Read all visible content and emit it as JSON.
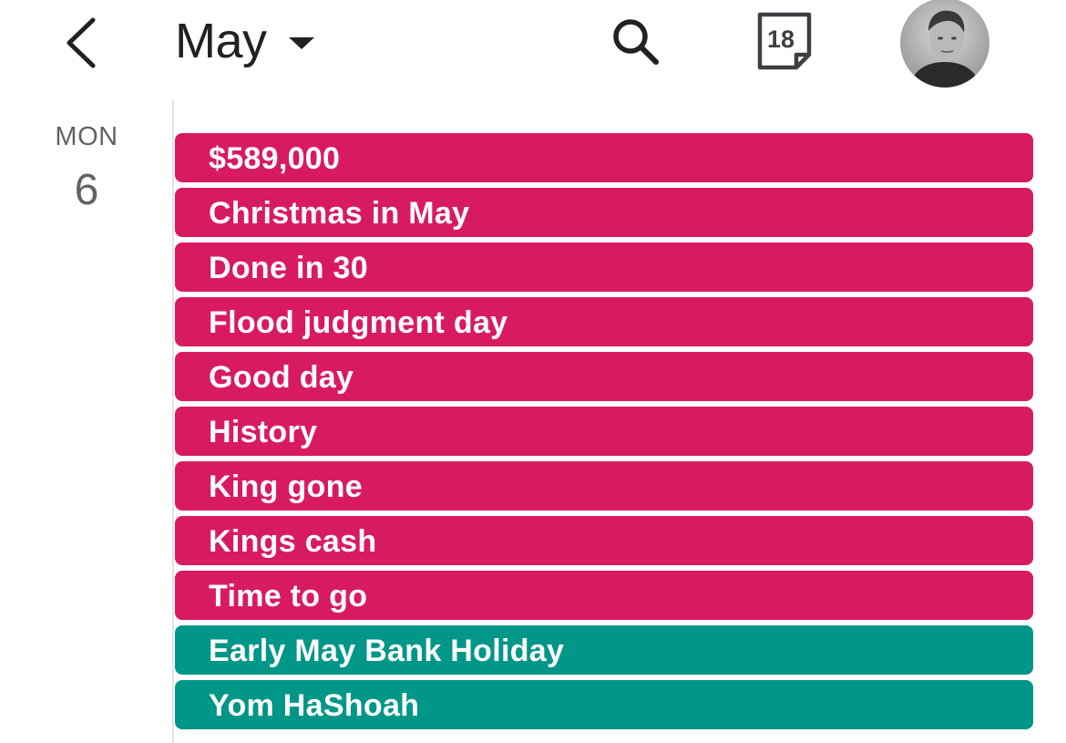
{
  "header": {
    "month": "May",
    "today_date": "18",
    "icons": {
      "back": "chevron-left-icon",
      "dropdown": "caret-down-icon",
      "search": "search-icon",
      "today": "calendar-today-icon",
      "avatar": "user-avatar"
    }
  },
  "day": {
    "name": "MON",
    "number": "6"
  },
  "colors": {
    "personal_event": "#d81b60",
    "holiday_event": "#009688",
    "text_primary": "#202124",
    "text_secondary": "#5f6368"
  },
  "events": [
    {
      "title": "$589,000",
      "color": "#d81b60"
    },
    {
      "title": "Christmas in May",
      "color": "#d81b60"
    },
    {
      "title": "Done in 30",
      "color": "#d81b60"
    },
    {
      "title": "Flood judgment day",
      "color": "#d81b60"
    },
    {
      "title": "Good day",
      "color": "#d81b60"
    },
    {
      "title": "History",
      "color": "#d81b60"
    },
    {
      "title": "King gone",
      "color": "#d81b60"
    },
    {
      "title": "Kings cash",
      "color": "#d81b60"
    },
    {
      "title": "Time to go",
      "color": "#d81b60"
    },
    {
      "title": "Early May Bank Holiday",
      "color": "#009688"
    },
    {
      "title": "Yom HaShoah",
      "color": "#009688"
    }
  ]
}
